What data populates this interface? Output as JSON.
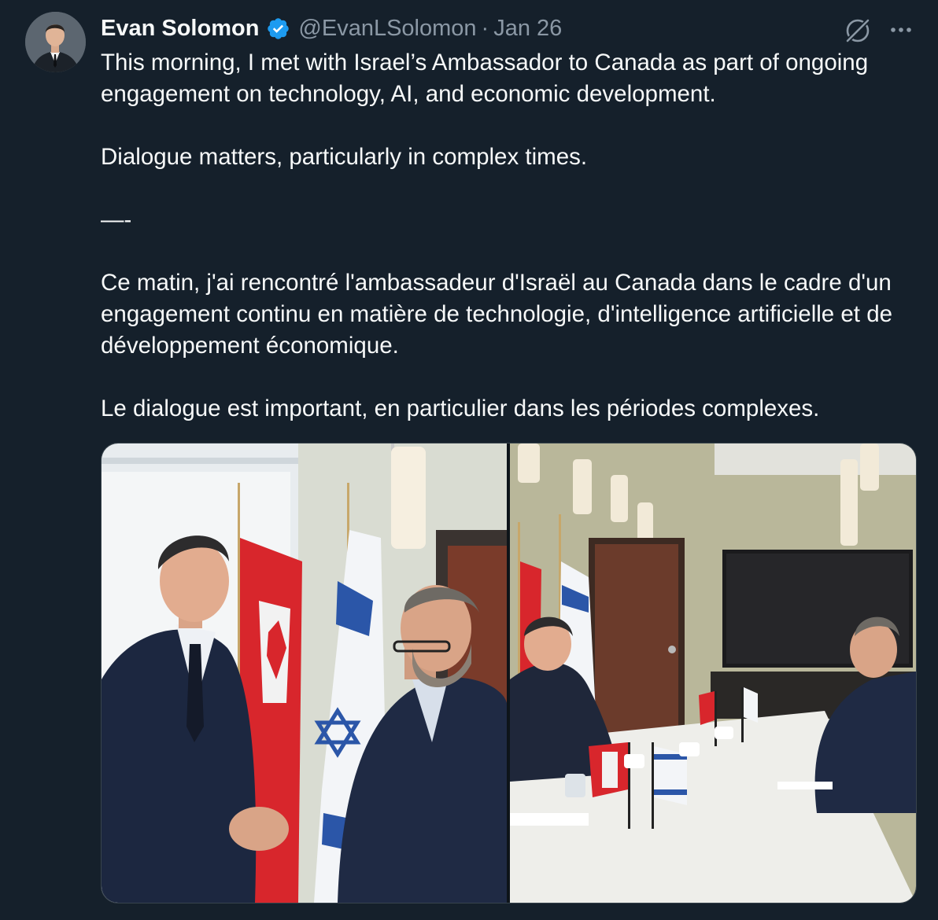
{
  "tweet": {
    "author": {
      "name": "Evan Solomon",
      "handle": "@EvanLSolomon",
      "verified": true,
      "avatar_icon": "avatar-photo"
    },
    "separator": "·",
    "date": "Jan 26",
    "paragraphs": [
      "This morning, I met with Israel’s Ambassador to Canada as part of ongoing engagement on technology, AI, and economic development.",
      "Dialogue matters, particularly in complex times.",
      "—-",
      "Ce matin, j'ai rencontré l'ambassadeur d'Israël au Canada dans le cadre d'un engagement continu en matière de technologie, d'intelligence artificielle et de développement économique.",
      "Le dialogue est important, en particulier dans les périodes complexes."
    ],
    "actions": {
      "grok_icon": "grok-icon",
      "more_icon": "more-icon"
    }
  },
  "colors": {
    "background": "#15202b",
    "text_primary": "#f7f9f9",
    "text_secondary": "#8b98a5",
    "verified": "#1d9bf0",
    "border": "#38444d"
  }
}
